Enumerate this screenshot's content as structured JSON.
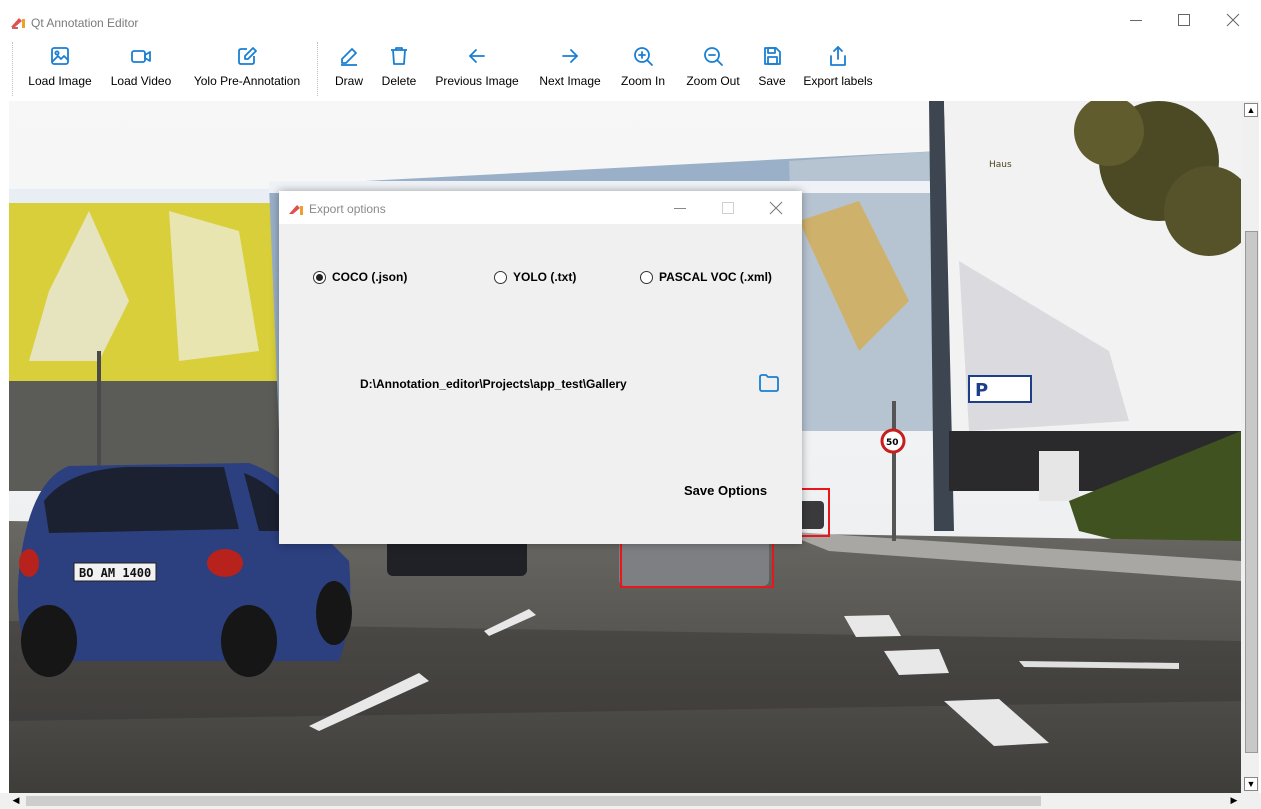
{
  "window": {
    "title": "Qt Annotation Editor"
  },
  "toolbar": {
    "load_image": "Load Image",
    "load_video": "Load Video",
    "yolo_pre_annotation": "Yolo Pre-Annotation",
    "draw": "Draw",
    "delete": "Delete",
    "previous_image": "Previous Image",
    "next_image": "Next Image",
    "zoom_in": "Zoom In",
    "zoom_out": "Zoom Out",
    "save": "Save",
    "export_labels": "Export labels"
  },
  "icons": {
    "load_image": "image-icon",
    "load_video": "video-camera-icon",
    "yolo_pre_annotation": "edit-icon",
    "draw": "pencil-icon",
    "delete": "trash-icon",
    "previous_image": "arrow-left-icon",
    "next_image": "arrow-right-icon",
    "zoom_in": "zoom-in-icon",
    "zoom_out": "zoom-out-icon",
    "save": "floppy-disk-icon",
    "export_labels": "share-upload-icon",
    "browse": "folder-icon"
  },
  "image": {
    "scene_text": {
      "sign_text": "Haus",
      "parking_sign": "P",
      "speed_sign": "50",
      "plate": "BO AM 1400"
    }
  },
  "dialog": {
    "title": "Export options",
    "formats": [
      {
        "label": "COCO (.json)",
        "checked": true
      },
      {
        "label": "YOLO (.txt)",
        "checked": false
      },
      {
        "label": "PASCAL VOC (.xml)",
        "checked": false
      }
    ],
    "path": "D:\\Annotation_editor\\Projects\\app_test\\Gallery",
    "save_button": "Save Options"
  },
  "colors": {
    "accent": "#1a7fd3",
    "bbox": "#e8171b",
    "dialog_bg": "#f0f0f0"
  }
}
